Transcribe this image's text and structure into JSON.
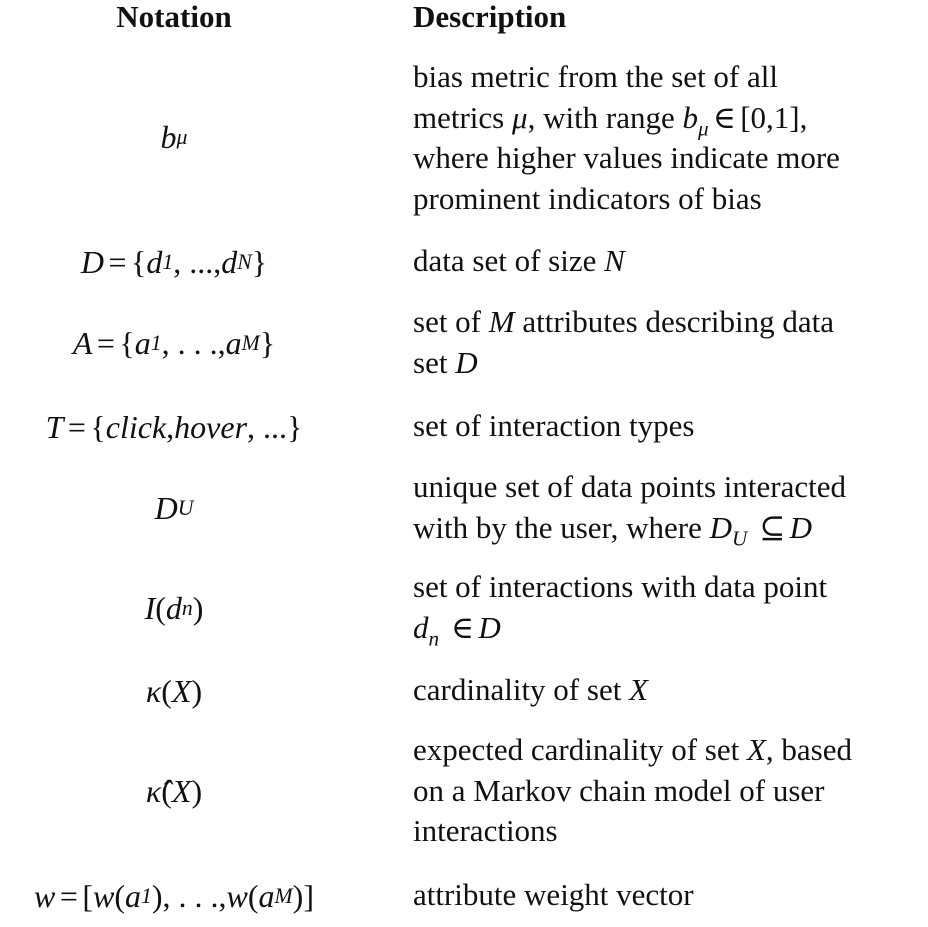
{
  "headers": {
    "notation": "Notation",
    "description": "Description"
  },
  "rows": [
    {
      "notation_text": "bμ",
      "description_lines": [
        "bias metric from the set of all",
        "metrics μ, with range bμ ∈ [0,1],",
        "where higher values indicate more",
        "prominent indicators of bias"
      ]
    },
    {
      "notation_text": "D = {d1, ..., dN}",
      "description_lines": [
        "data set of size N"
      ]
    },
    {
      "notation_text": "A = {a1, . . . , aM}",
      "description_lines": [
        "set of M attributes describing data",
        "set D"
      ]
    },
    {
      "notation_text": "T = {click, hover, ...}",
      "description_lines": [
        "set of interaction types"
      ]
    },
    {
      "notation_text": "DU",
      "description_lines": [
        "unique set of data points interacted",
        "with by the user, where DU ⊆ D"
      ]
    },
    {
      "notation_text": "I(dn)",
      "description_lines": [
        "set of interactions with data point",
        "dn ∈ D"
      ]
    },
    {
      "notation_text": "κ(X)",
      "description_lines": [
        "cardinality of set X"
      ]
    },
    {
      "notation_text": "κ̂(X)",
      "description_lines": [
        "expected cardinality of set X, based",
        "on a Markov chain model of user",
        "interactions"
      ]
    },
    {
      "notation_text": "w = [w(a1), . . . , w(aM)]",
      "description_lines": [
        "attribute weight vector"
      ]
    }
  ]
}
